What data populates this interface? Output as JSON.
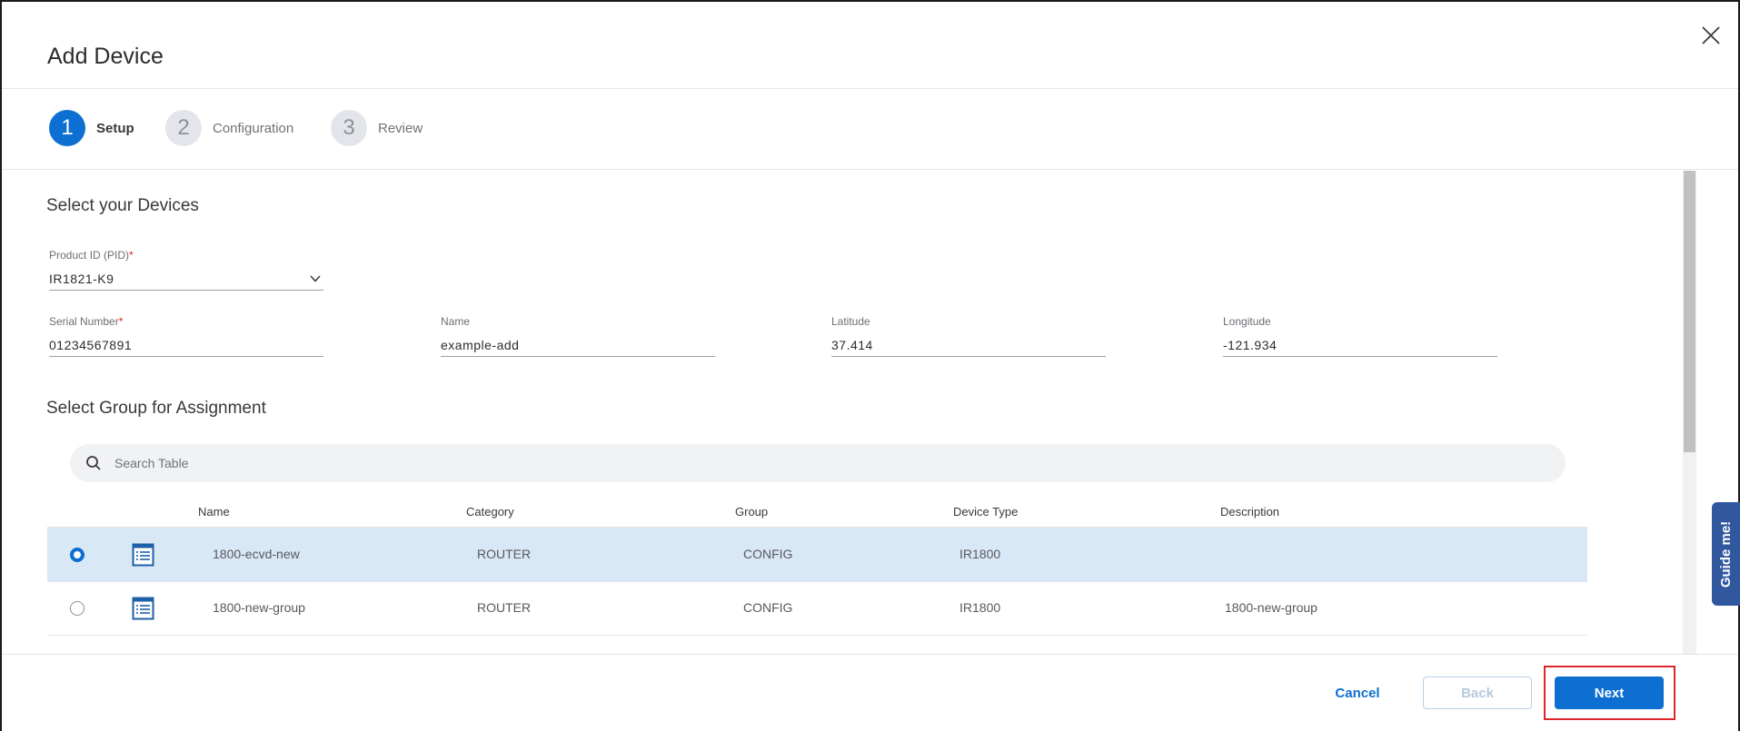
{
  "modal": {
    "title": "Add Device",
    "close_icon": "close-icon"
  },
  "stepper": {
    "steps": [
      {
        "number": "1",
        "label": "Setup",
        "state": "active"
      },
      {
        "number": "2",
        "label": "Configuration",
        "state": "inactive"
      },
      {
        "number": "3",
        "label": "Review",
        "state": "inactive"
      }
    ]
  },
  "devices": {
    "section_title": "Select your Devices",
    "pid": {
      "label": "Product ID (PID)",
      "required_mark": "*",
      "value": "IR1821-K9"
    },
    "serial": {
      "label": "Serial Number",
      "required_mark": "*",
      "value": "01234567891"
    },
    "name": {
      "label": "Name",
      "value": "example-add"
    },
    "latitude": {
      "label": "Latitude",
      "value": "37.414"
    },
    "longitude": {
      "label": "Longitude",
      "value": "-121.934"
    }
  },
  "groups": {
    "section_title": "Select Group for Assignment",
    "search": {
      "placeholder": "Search Table",
      "value": ""
    },
    "columns": [
      "Name",
      "Category",
      "Group",
      "Device Type",
      "Description"
    ],
    "rows": [
      {
        "selected": true,
        "name": "1800-ecvd-new",
        "category": "ROUTER",
        "group": "CONFIG",
        "device_type": "IR1800",
        "description": ""
      },
      {
        "selected": false,
        "name": "1800-new-group",
        "category": "ROUTER",
        "group": "CONFIG",
        "device_type": "IR1800",
        "description": "1800-new-group"
      }
    ]
  },
  "guide": {
    "label": "Guide me!"
  },
  "footer": {
    "cancel_label": "Cancel",
    "back_label": "Back",
    "next_label": "Next"
  },
  "colors": {
    "accent": "#0d6fd1",
    "selected_row": "#d9e8f7",
    "required": "#e2231a",
    "highlight": "#e0262b",
    "guide_tab": "#31579e"
  }
}
